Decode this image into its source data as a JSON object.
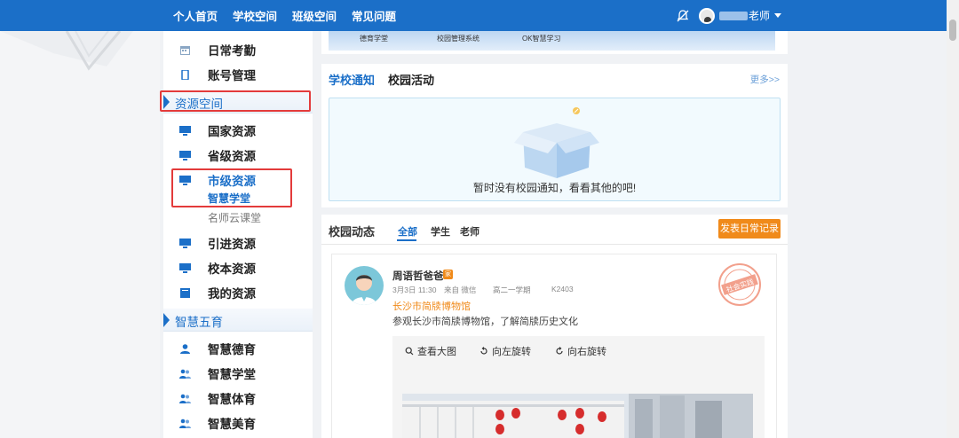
{
  "nav": {
    "items": [
      "个人首页",
      "学校空间",
      "班级空间",
      "常见问题"
    ],
    "user_suffix": "老师"
  },
  "sidebar": {
    "items_top": [
      {
        "label": "日常考勤",
        "icon": "calendar-icon"
      },
      {
        "label": "账号管理",
        "icon": "phone-icon"
      }
    ],
    "section_resources": "资源空间",
    "resources": [
      {
        "label": "国家资源",
        "icon": "monitor-icon"
      },
      {
        "label": "省级资源",
        "icon": "monitor-icon"
      },
      {
        "label": "市级资源",
        "icon": "monitor-icon",
        "active": true
      }
    ],
    "city_sub_active": "智慧学堂",
    "city_sub_other": "名师云课堂",
    "resources_more": [
      {
        "label": "引进资源",
        "icon": "monitor-icon"
      },
      {
        "label": "校本资源",
        "icon": "monitor-icon"
      },
      {
        "label": "我的资源",
        "icon": "book-icon"
      }
    ],
    "section_education": "智慧五育",
    "education": [
      {
        "label": "智慧德育",
        "icon": "person-icon"
      },
      {
        "label": "智慧学堂",
        "icon": "people-icon"
      },
      {
        "label": "智慧体育",
        "icon": "people-icon"
      },
      {
        "label": "智慧美育",
        "icon": "people-icon"
      }
    ]
  },
  "banner": {
    "links": [
      "德育学堂",
      "校园管理系统",
      "OK智慧学习"
    ]
  },
  "notice": {
    "tab_school": "学校通知",
    "tab_campus": "校园活动",
    "more": "更多>>",
    "empty": "暂时没有校园通知，看看其他的吧!"
  },
  "feed": {
    "title": "校园动态",
    "tabs": [
      "全部",
      "学生",
      "老师"
    ],
    "post_button": "发表日常记录",
    "post": {
      "author": "周语哲爸爸",
      "badge": "家",
      "date": "3月3日 11:30",
      "source": "来自 微信",
      "term": "高二一学期",
      "class_code": "K2403",
      "location": "长沙市简牍博物馆",
      "content": "参观长沙市简牍博物馆，了解简牍历史文化",
      "stamp_text": "社会实践",
      "tools": [
        "查看大图",
        "向左旋转",
        "向右旋转"
      ]
    }
  },
  "colors": {
    "brand": "#1b6fc8",
    "accent": "#f08a1a",
    "highlight_box": "#e33b3b"
  }
}
